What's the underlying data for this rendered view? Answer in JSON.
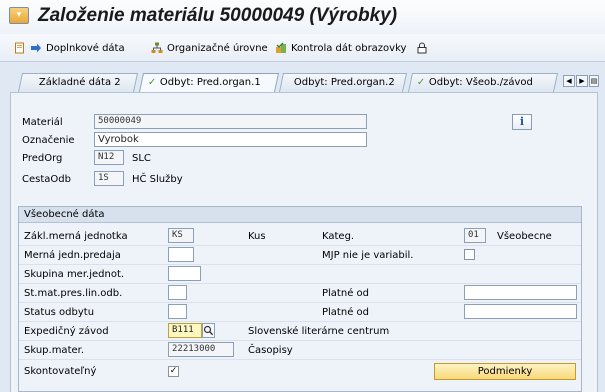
{
  "window": {
    "title": "Založenie materiálu 50000049 (Výrobky)"
  },
  "toolbar": {
    "additional_data": "Doplnkové dáta",
    "org_levels": "Organizačné úrovne",
    "check_screen": "Kontrola dát obrazovky"
  },
  "tabs": [
    {
      "label": "Základné dáta 2"
    },
    {
      "label": "Odbyt: Pred.organ.1"
    },
    {
      "label": "Odbyt: Pred.organ.2"
    },
    {
      "label": "Odbyt: Všeob./závod"
    }
  ],
  "header": {
    "material_label": "Materiál",
    "material_value": "50000049",
    "desc_label": "Označenie",
    "desc_value": "Vyrobok",
    "salesorg_label": "PredOrg",
    "salesorg_code": "N12",
    "salesorg_text": "SLC",
    "distch_label": "CestaOdb",
    "distch_code": "1S",
    "distch_text": "HČ Služby"
  },
  "general": {
    "title": "Všeobecné dáta",
    "base_uom_label": "Zákl.merná jednotka",
    "base_uom_value": "KS",
    "base_uom_text": "Kus",
    "category_label": "Kateg.",
    "category_value": "01",
    "category_text": "Všeobecne",
    "sales_unit_label": "Merná jedn.predaja",
    "mjp_label": "MJP nie je variabil.",
    "uom_group_label": "Skupina mer.jednot.",
    "xplant_status_label": "St.mat.pres.lin.odb.",
    "valid_from_label_1": "Platné od",
    "sales_status_label": "Status odbytu",
    "valid_from_label_2": "Platné od",
    "delivering_plant_label": "Expedičný závod",
    "delivering_plant_value": "B111",
    "delivering_plant_text": "Slovenské literárne centrum",
    "material_group_label": "Skup.mater.",
    "material_group_value": "22213000",
    "material_group_text": "Časopisy",
    "discount_label": "Skontovateľný",
    "discount_check": "✓",
    "conditions_button": "Podmienky"
  },
  "info_glyph": "i",
  "icons": [
    "app-icon",
    "new-doc-icon",
    "arrow-right-icon",
    "org-levels-icon",
    "check-data-icon",
    "lock-icon",
    "checkmark-icon",
    "search-icon",
    "info-icon"
  ]
}
